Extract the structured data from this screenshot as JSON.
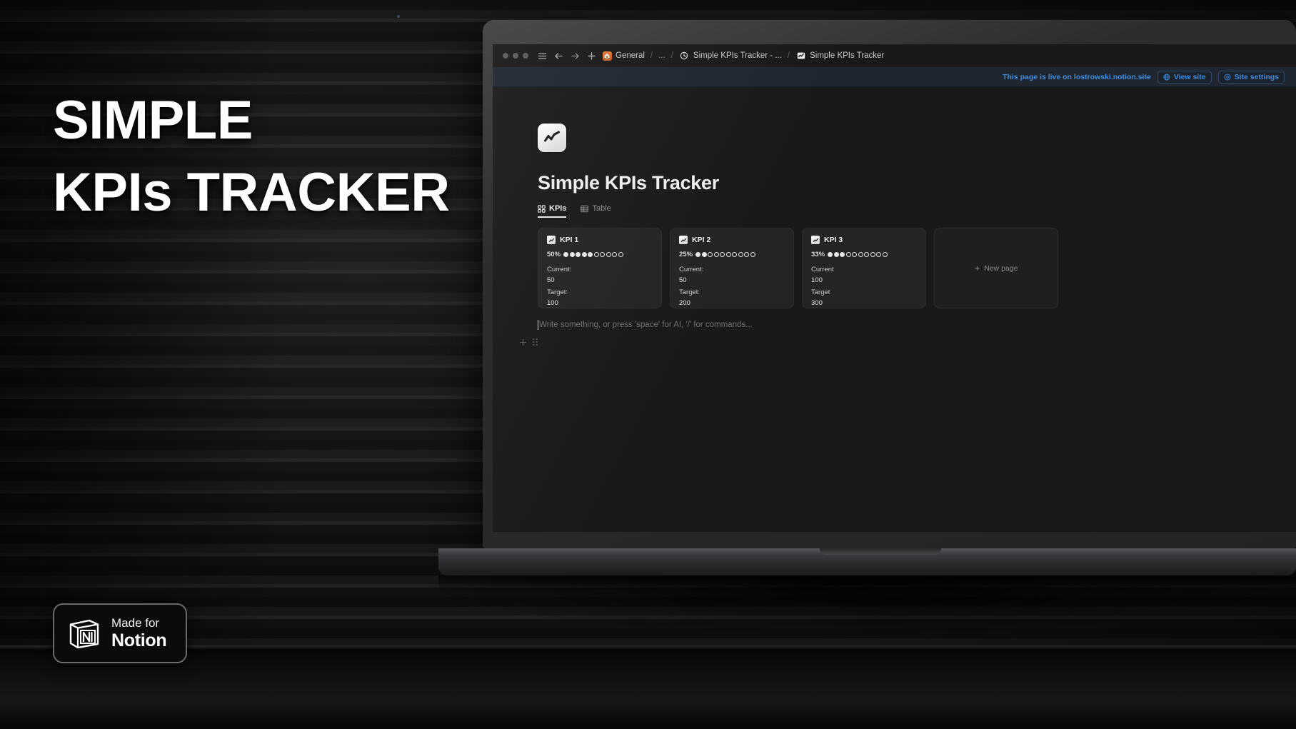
{
  "hero": {
    "line1": "SIMPLE",
    "line2": "KPIs TRACKER"
  },
  "badge": {
    "made_for": "Made for",
    "brand": "Notion",
    "icon": "notion-logo-icon"
  },
  "browser": {
    "window_controls": [
      "close",
      "minimize",
      "maximize"
    ],
    "sidebar_toggle_icon": "hamburger-icon",
    "back_icon": "arrow-left-icon",
    "forward_icon": "arrow-right-icon",
    "new_tab_icon": "plus-icon",
    "breadcrumb": [
      {
        "emoji": "🏠",
        "label": "General"
      },
      {
        "label": "..."
      },
      {
        "icon": "clock-icon",
        "label": "Simple KPIs Tracker - ..."
      },
      {
        "icon": "chart-icon",
        "label": "Simple KPIs Tracker"
      }
    ],
    "separator": "/"
  },
  "live_banner": {
    "message": "This page is live on lostrowski.notion.site",
    "view_site_label": "View site",
    "view_site_icon": "globe-icon",
    "site_settings_label": "Site settings",
    "site_settings_icon": "gear-icon",
    "accent_color": "#3d8ce0",
    "background_color": "#1f2630"
  },
  "page": {
    "icon": "line-chart-icon",
    "title": "Simple KPIs Tracker",
    "tabs": [
      {
        "label": "KPIs",
        "icon": "gallery-icon",
        "active": true
      },
      {
        "label": "Table",
        "icon": "table-icon",
        "active": false
      }
    ],
    "placeholder": "Write something, or press 'space' for AI, '/' for commands...",
    "add_block_icon": "plus-icon",
    "drag_handle_icon": "drag-handle-icon"
  },
  "kpi_cards": [
    {
      "icon": "chart-icon",
      "title": "KPI 1",
      "percent": "50%",
      "filled_dots": 5,
      "total_dots": 10,
      "current_label": "Current:",
      "current_value": "50",
      "target_label": "Target:",
      "target_value": "100"
    },
    {
      "icon": "chart-icon",
      "title": "KPI 2",
      "percent": "25%",
      "filled_dots": 2,
      "total_dots": 10,
      "current_label": "Current:",
      "current_value": "50",
      "target_label": "Target:",
      "target_value": "200"
    },
    {
      "icon": "chart-icon",
      "title": "KPI 3",
      "percent": "33%",
      "filled_dots": 3,
      "total_dots": 10,
      "current_label": "Current",
      "current_value": "100",
      "target_label": "Target",
      "target_value": "300"
    }
  ],
  "new_page_card": {
    "label": "New page",
    "icon": "plus-icon"
  }
}
